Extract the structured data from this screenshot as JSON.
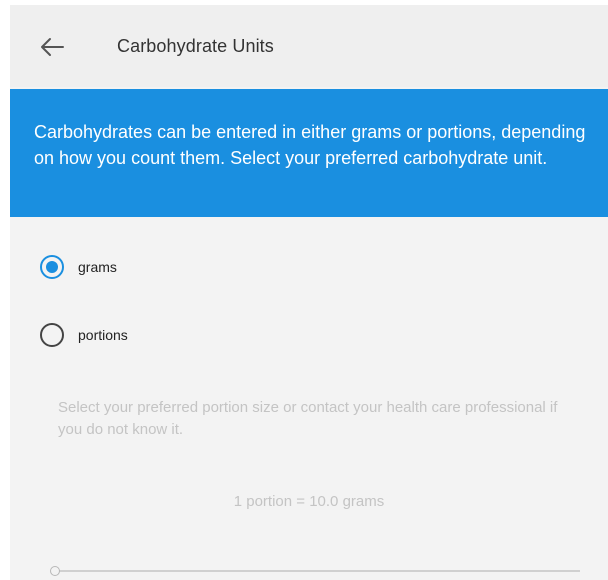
{
  "header": {
    "title": "Carbohydrate Units",
    "back_icon": "arrow-left-icon"
  },
  "banner": {
    "text": "Carbohydrates can be entered in either grams or portions, depending on how you count them. Select your preferred carbohydrate unit."
  },
  "options": [
    {
      "label": "grams",
      "selected": true
    },
    {
      "label": "portions",
      "selected": false
    }
  ],
  "portion": {
    "help_text": "Select your preferred portion size or contact your health care professional if you do not know it.",
    "value_text": "1 portion = 10.0 grams",
    "slider_level": 0
  },
  "colors": {
    "accent": "#1a8fe0",
    "disabled_text": "#c4c4c4"
  }
}
